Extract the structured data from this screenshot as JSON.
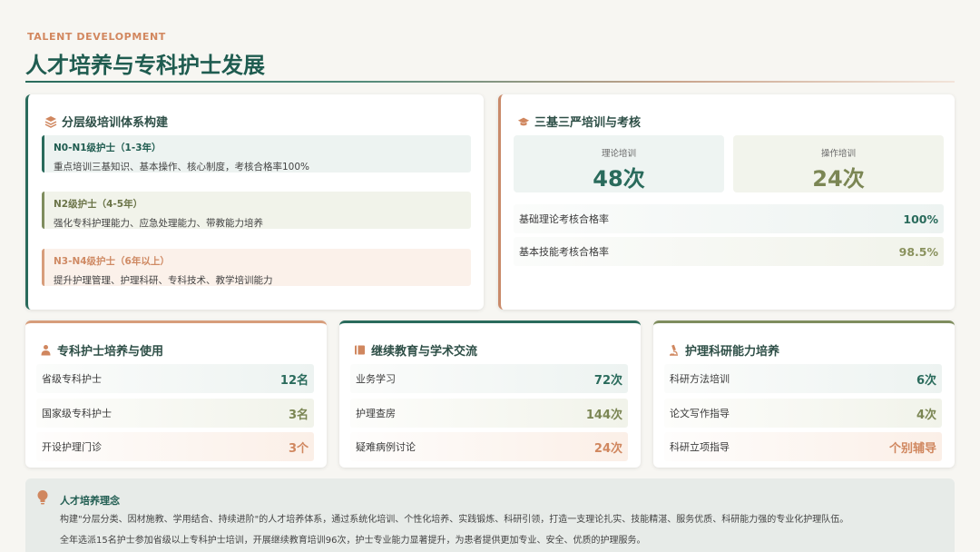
{
  "header": {
    "subtitle": "TALENT DEVELOPMENT",
    "title": "人才培养与专科护士发展"
  },
  "tiers": {
    "title": "分层级培训体系构建",
    "icon": "layers-icon",
    "items": [
      {
        "head": "N0-N1级护士（1-3年）",
        "desc": "重点培训三基知识、基本操作、核心制度，考核合格率100%"
      },
      {
        "head": "N2级护士（4-5年）",
        "desc": "强化专科护理能力、应急处理能力、带教能力培养"
      },
      {
        "head": "N3-N4级护士（6年以上）",
        "desc": "提升护理管理、护理科研、专科技术、教学培训能力"
      }
    ]
  },
  "training": {
    "title": "三基三严培训与考核",
    "icon": "graduation-cap-icon",
    "stats": [
      {
        "label": "理论培训",
        "value": "48次"
      },
      {
        "label": "操作培训",
        "value": "24次"
      }
    ],
    "rates": [
      {
        "label": "基础理论考核合格率",
        "value": "100%"
      },
      {
        "label": "基本技能考核合格率",
        "value": "98.5%"
      }
    ]
  },
  "specialist": {
    "title": "专科护士培养与使用",
    "icon": "nurse-icon",
    "rows": [
      {
        "label": "省级专科护士",
        "value": "12名"
      },
      {
        "label": "国家级专科护士",
        "value": "3名"
      },
      {
        "label": "开设护理门诊",
        "value": "3个"
      }
    ]
  },
  "education": {
    "title": "继续教育与学术交流",
    "icon": "book-icon",
    "rows": [
      {
        "label": "业务学习",
        "value": "72次"
      },
      {
        "label": "护理查房",
        "value": "144次"
      },
      {
        "label": "疑难病例讨论",
        "value": "24次"
      }
    ]
  },
  "research": {
    "title": "护理科研能力培养",
    "icon": "microscope-icon",
    "rows": [
      {
        "label": "科研方法培训",
        "value": "6次"
      },
      {
        "label": "论文写作指导",
        "value": "4次"
      },
      {
        "label": "科研立项指导",
        "value": "个别辅导"
      }
    ]
  },
  "philosophy": {
    "title": "人才培养理念",
    "icon": "lightbulb-icon",
    "line1": "构建\"分层分类、因材施教、学用结合、持续进阶\"的人才培养体系，通过系统化培训、个性化培养、实践锻炼、科研引领，打造一支理论扎实、技能精湛、服务优质、科研能力强的专业化护理队伍。",
    "line2": "全年选派15名护士参加省级以上专科护士培训，开展继续教育培训96次，护士专业能力显著提升，为患者提供更加专业、安全、优质的护理服务。"
  },
  "colors": {
    "primary": "#2a6b5c",
    "olive": "#7b8654",
    "accent": "#d0875f"
  }
}
